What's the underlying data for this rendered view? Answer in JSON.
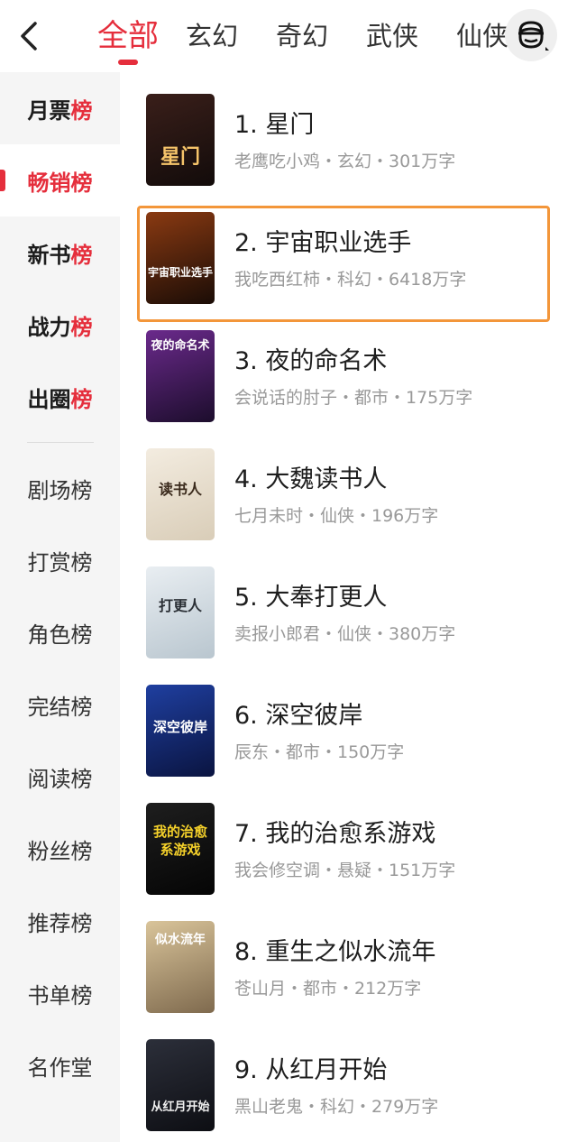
{
  "header": {
    "back_icon": "chevron-left-icon",
    "tabs": [
      {
        "label": "全部",
        "active": true
      },
      {
        "label": "玄幻",
        "active": false
      },
      {
        "label": "奇幻",
        "active": false
      },
      {
        "label": "武侠",
        "active": false
      },
      {
        "label": "仙侠",
        "active": false
      }
    ],
    "avatar_icon": "monkey-avatar-icon"
  },
  "sidebar": {
    "items": [
      {
        "prefix": "月票",
        "suffix": "榜",
        "bold": true,
        "active": false
      },
      {
        "prefix": "畅销",
        "suffix": "榜",
        "bold": true,
        "active": true
      },
      {
        "prefix": "新书",
        "suffix": "榜",
        "bold": true,
        "active": false
      },
      {
        "prefix": "战力",
        "suffix": "榜",
        "bold": true,
        "active": false
      },
      {
        "prefix": "出圈",
        "suffix": "榜",
        "bold": true,
        "active": false
      },
      {
        "prefix": "剧场",
        "suffix": "榜",
        "bold": false,
        "active": false
      },
      {
        "prefix": "打赏",
        "suffix": "榜",
        "bold": false,
        "active": false
      },
      {
        "prefix": "角色",
        "suffix": "榜",
        "bold": false,
        "active": false
      },
      {
        "prefix": "完结",
        "suffix": "榜",
        "bold": false,
        "active": false
      },
      {
        "prefix": "阅读",
        "suffix": "榜",
        "bold": false,
        "active": false
      },
      {
        "prefix": "粉丝",
        "suffix": "榜",
        "bold": false,
        "active": false
      },
      {
        "prefix": "推荐",
        "suffix": "榜",
        "bold": false,
        "active": false
      },
      {
        "prefix": "书单",
        "suffix": "榜",
        "bold": false,
        "active": false
      },
      {
        "prefix": "名作",
        "suffix": "堂",
        "bold": false,
        "active": false
      }
    ]
  },
  "books": [
    {
      "title": "1. 星门",
      "meta": "老鹰吃小鸡・玄幻・301万字",
      "cover_text": "星门",
      "cover_colors": [
        "#3a1f1a",
        "#120b0a"
      ],
      "cover_text_color": "#f6c46a",
      "highlight": false
    },
    {
      "title": "2. 宇宙职业选手",
      "meta": "我吃西红柿・科幻・6418万字",
      "cover_text": "宇宙职业选手",
      "cover_colors": [
        "#8a3a12",
        "#1a0c06"
      ],
      "cover_text_color": "#ffffff",
      "highlight": true
    },
    {
      "title": "3. 夜的命名术",
      "meta": "会说话的肘子・都市・175万字",
      "cover_text": "夜的命名术",
      "cover_colors": [
        "#6b2a8c",
        "#1c0d2c"
      ],
      "cover_text_color": "#ffffff",
      "highlight": false
    },
    {
      "title": "4. 大魏读书人",
      "meta": "七月未时・仙侠・196万字",
      "cover_text": "读书人",
      "cover_colors": [
        "#f3ece0",
        "#d9cdb8"
      ],
      "cover_text_color": "#3a2a1c",
      "highlight": false
    },
    {
      "title": "5. 大奉打更人",
      "meta": "卖报小郎君・仙侠・380万字",
      "cover_text": "打更人",
      "cover_colors": [
        "#e9eef2",
        "#b9c6cf"
      ],
      "cover_text_color": "#2a2f35",
      "highlight": false
    },
    {
      "title": "6. 深空彼岸",
      "meta": "辰东・都市・150万字",
      "cover_text": "深空彼岸",
      "cover_colors": [
        "#1f3fa0",
        "#0a1440"
      ],
      "cover_text_color": "#ffffff",
      "highlight": false
    },
    {
      "title": "7. 我的治愈系游戏",
      "meta": "我会修空调・悬疑・151万字",
      "cover_text": "我的治愈系游戏",
      "cover_colors": [
        "#1e1e1e",
        "#050505"
      ],
      "cover_text_color": "#f5d12a",
      "highlight": false
    },
    {
      "title": "8. 重生之似水流年",
      "meta": "苍山月・都市・212万字",
      "cover_text": "似水流年",
      "cover_colors": [
        "#d9c49a",
        "#7f6a4e"
      ],
      "cover_text_color": "#ffffff",
      "highlight": false
    },
    {
      "title": "9. 从红月开始",
      "meta": "黑山老鬼・科幻・279万字",
      "cover_text": "从红月开始",
      "cover_colors": [
        "#2c2f3a",
        "#0d0e13"
      ],
      "cover_text_color": "#f0f0f0",
      "highlight": false
    }
  ]
}
